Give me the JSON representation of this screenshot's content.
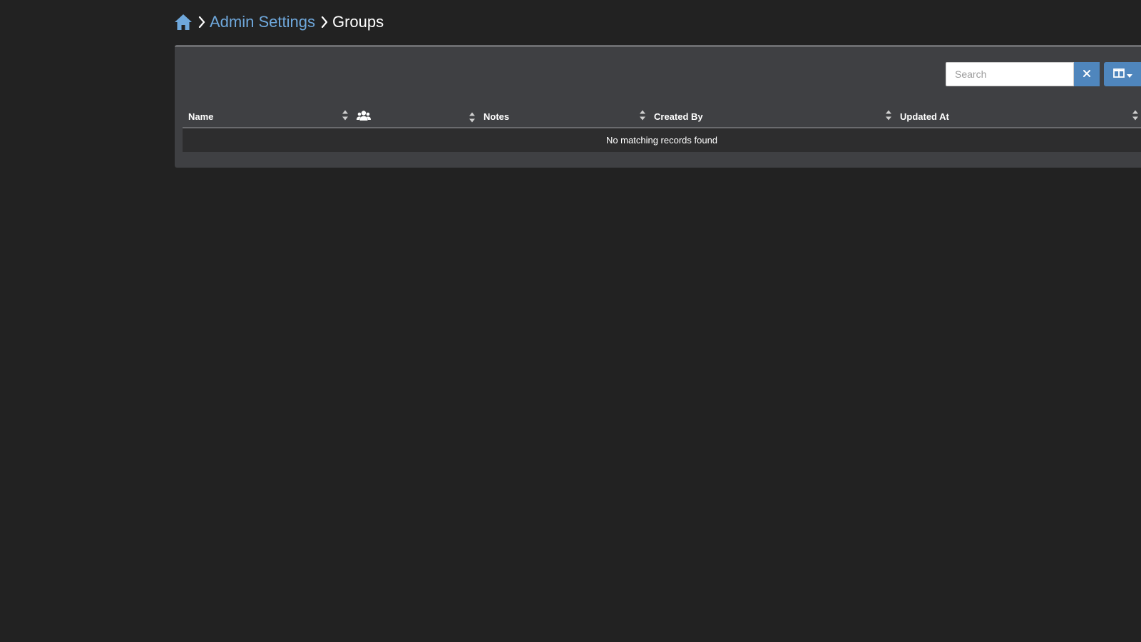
{
  "breadcrumb": {
    "home_icon": "home-icon",
    "items": [
      {
        "label": "Admin Settings",
        "link": true
      },
      {
        "label": "Groups",
        "link": false
      }
    ],
    "separator_icon": "chevron-right-icon"
  },
  "toolbar": {
    "search_placeholder": "Search",
    "search_value": "",
    "clear_icon": "close-icon",
    "columns_icon": "columns-icon"
  },
  "table": {
    "columns": [
      {
        "label": "Name",
        "icon": null
      },
      {
        "label": "",
        "icon": "users-icon"
      },
      {
        "label": "Notes",
        "icon": null
      },
      {
        "label": "Created By",
        "icon": null
      },
      {
        "label": "Updated At",
        "icon": null
      }
    ],
    "rows": [],
    "empty_message": "No matching records found"
  },
  "colors": {
    "background": "#222222",
    "panel": "#3f4043",
    "accent": "#4f86bd",
    "link": "#6fa8dc"
  }
}
